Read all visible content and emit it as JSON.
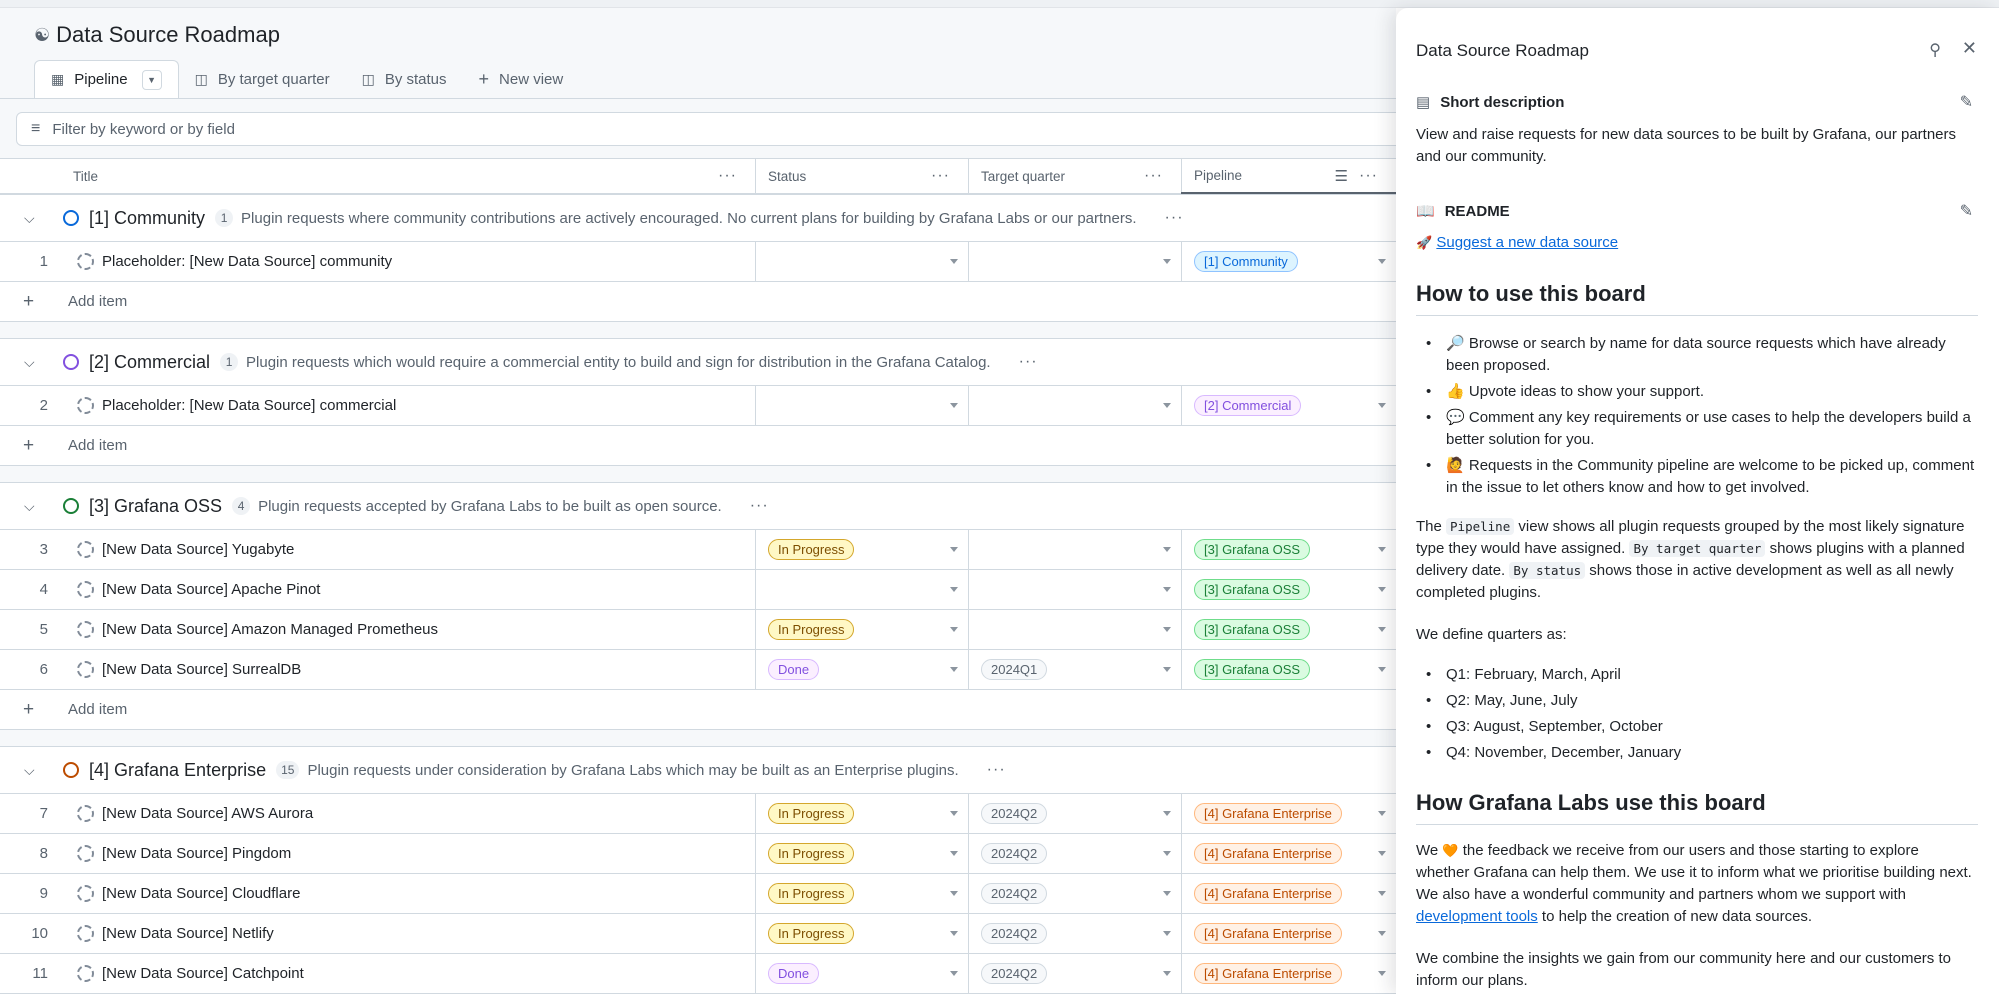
{
  "project": {
    "title": "Data Source Roadmap"
  },
  "tabs": [
    {
      "label": "Pipeline"
    },
    {
      "label": "By target quarter"
    },
    {
      "label": "By status"
    },
    {
      "label": "New view"
    }
  ],
  "filter": {
    "placeholder": "Filter by keyword or by field"
  },
  "columns": [
    "Title",
    "Status",
    "Target quarter",
    "Pipeline"
  ],
  "add_item_label": "Add item",
  "groups": [
    {
      "name": "[1] Community",
      "count": "1",
      "color": "#0969da",
      "description": "Plugin requests where community contributions are actively encouraged. No current plans for building by Grafana Labs or our partners.",
      "rows": [
        {
          "num": "1",
          "title": "Placeholder: [New Data Source] community",
          "status": "",
          "quarter": "",
          "pipeline": "[1] Community"
        }
      ]
    },
    {
      "name": "[2] Commercial",
      "count": "1",
      "color": "#8250df",
      "description": "Plugin requests which would require a commercial entity to build and sign for distribution in the Grafana Catalog.",
      "rows": [
        {
          "num": "2",
          "title": "Placeholder: [New Data Source] commercial",
          "status": "",
          "quarter": "",
          "pipeline": "[2] Commercial"
        }
      ]
    },
    {
      "name": "[3] Grafana OSS",
      "count": "4",
      "color": "#1a7f37",
      "description": "Plugin requests accepted by Grafana Labs to be built as open source.",
      "rows": [
        {
          "num": "3",
          "title": "[New Data Source] Yugabyte",
          "status": "In Progress",
          "quarter": "",
          "pipeline": "[3] Grafana OSS"
        },
        {
          "num": "4",
          "title": "[New Data Source] Apache Pinot",
          "status": "",
          "quarter": "",
          "pipeline": "[3] Grafana OSS"
        },
        {
          "num": "5",
          "title": "[New Data Source] Amazon Managed Prometheus",
          "status": "In Progress",
          "quarter": "",
          "pipeline": "[3] Grafana OSS"
        },
        {
          "num": "6",
          "title": "[New Data Source] SurrealDB",
          "status": "Done",
          "quarter": "2024Q1",
          "pipeline": "[3] Grafana OSS"
        }
      ]
    },
    {
      "name": "[4] Grafana Enterprise",
      "count": "15",
      "color": "#bc4c00",
      "description": "Plugin requests under consideration by Grafana Labs which may be built as an Enterprise plugins.",
      "rows": [
        {
          "num": "7",
          "title": "[New Data Source] AWS Aurora",
          "status": "In Progress",
          "quarter": "2024Q2",
          "pipeline": "[4] Grafana Enterprise"
        },
        {
          "num": "8",
          "title": "[New Data Source] Pingdom",
          "status": "In Progress",
          "quarter": "2024Q2",
          "pipeline": "[4] Grafana Enterprise"
        },
        {
          "num": "9",
          "title": "[New Data Source] Cloudflare",
          "status": "In Progress",
          "quarter": "2024Q2",
          "pipeline": "[4] Grafana Enterprise"
        },
        {
          "num": "10",
          "title": "[New Data Source] Netlify",
          "status": "In Progress",
          "quarter": "2024Q2",
          "pipeline": "[4] Grafana Enterprise"
        },
        {
          "num": "11",
          "title": "[New Data Source] Catchpoint",
          "status": "Done",
          "quarter": "2024Q2",
          "pipeline": "[4] Grafana Enterprise"
        }
      ]
    }
  ],
  "badge_colors": {
    "In Progress": {
      "bg": "#fff8c5",
      "fg": "#7d4e00",
      "border": "#d4a72c"
    },
    "Done": {
      "bg": "#fbefff",
      "fg": "#8250df",
      "border": "#d8b9ff"
    },
    "quarter": {
      "bg": "#f6f8fa",
      "fg": "#59636e",
      "border": "#d1d9e0"
    },
    "[1] Community": {
      "bg": "#ddf4ff",
      "fg": "#0969da",
      "border": "#8fc3ff"
    },
    "[2] Commercial": {
      "bg": "#fbefff",
      "fg": "#8250df",
      "border": "#d8b9ff"
    },
    "[3] Grafana OSS": {
      "bg": "#dafbe1",
      "fg": "#1a7f37",
      "border": "#6fdd8b"
    },
    "[4] Grafana Enterprise": {
      "bg": "#fff1e5",
      "fg": "#bc4c00",
      "border": "#ffb77c"
    }
  },
  "panel": {
    "title": "Data Source Roadmap",
    "short_description_label": "Short description",
    "short_description": "View and raise requests for new data sources to be built by Grafana, our partners and our community.",
    "readme_label": "README",
    "suggest_link": "Suggest a new data source",
    "h_how_to_use": "How to use this board",
    "how_to_list": [
      "Browse or search by name for data source requests which have already been proposed.",
      "Upvote ideas to show your support.",
      "Comment any key requirements or use cases to help the developers build a better solution for you.",
      "Requests in the Community pipeline are welcome to be picked up, comment in the issue to let others know and how to get involved."
    ],
    "views_text": {
      "p1": "The",
      "c1": "Pipeline",
      "p2": "view shows all plugin requests grouped by the most likely signature type they would have assigned.",
      "c2": "By target quarter",
      "p3": "shows plugins with a planned delivery date.",
      "c3": "By status",
      "p4": "shows those in active development as well as all newly completed plugins."
    },
    "quarters_intro": "We define quarters as:",
    "quarters": [
      "Q1: February, March, April",
      "Q2: May, June, July",
      "Q3: August, September, October",
      "Q4: November, December, January"
    ],
    "h_grafana_use": "How Grafana Labs use this board",
    "feedback_text": {
      "p1": "We",
      "p2": "the feedback we receive from our users and those starting to explore whether Grafana can help them. We use it to inform what we prioritise building next. We also have a wonderful community and partners whom we support with",
      "link": "development tools",
      "p3": "to help the creation of new data sources."
    },
    "insights_text": "We combine the insights we gain from our community here and our customers to inform our plans."
  }
}
